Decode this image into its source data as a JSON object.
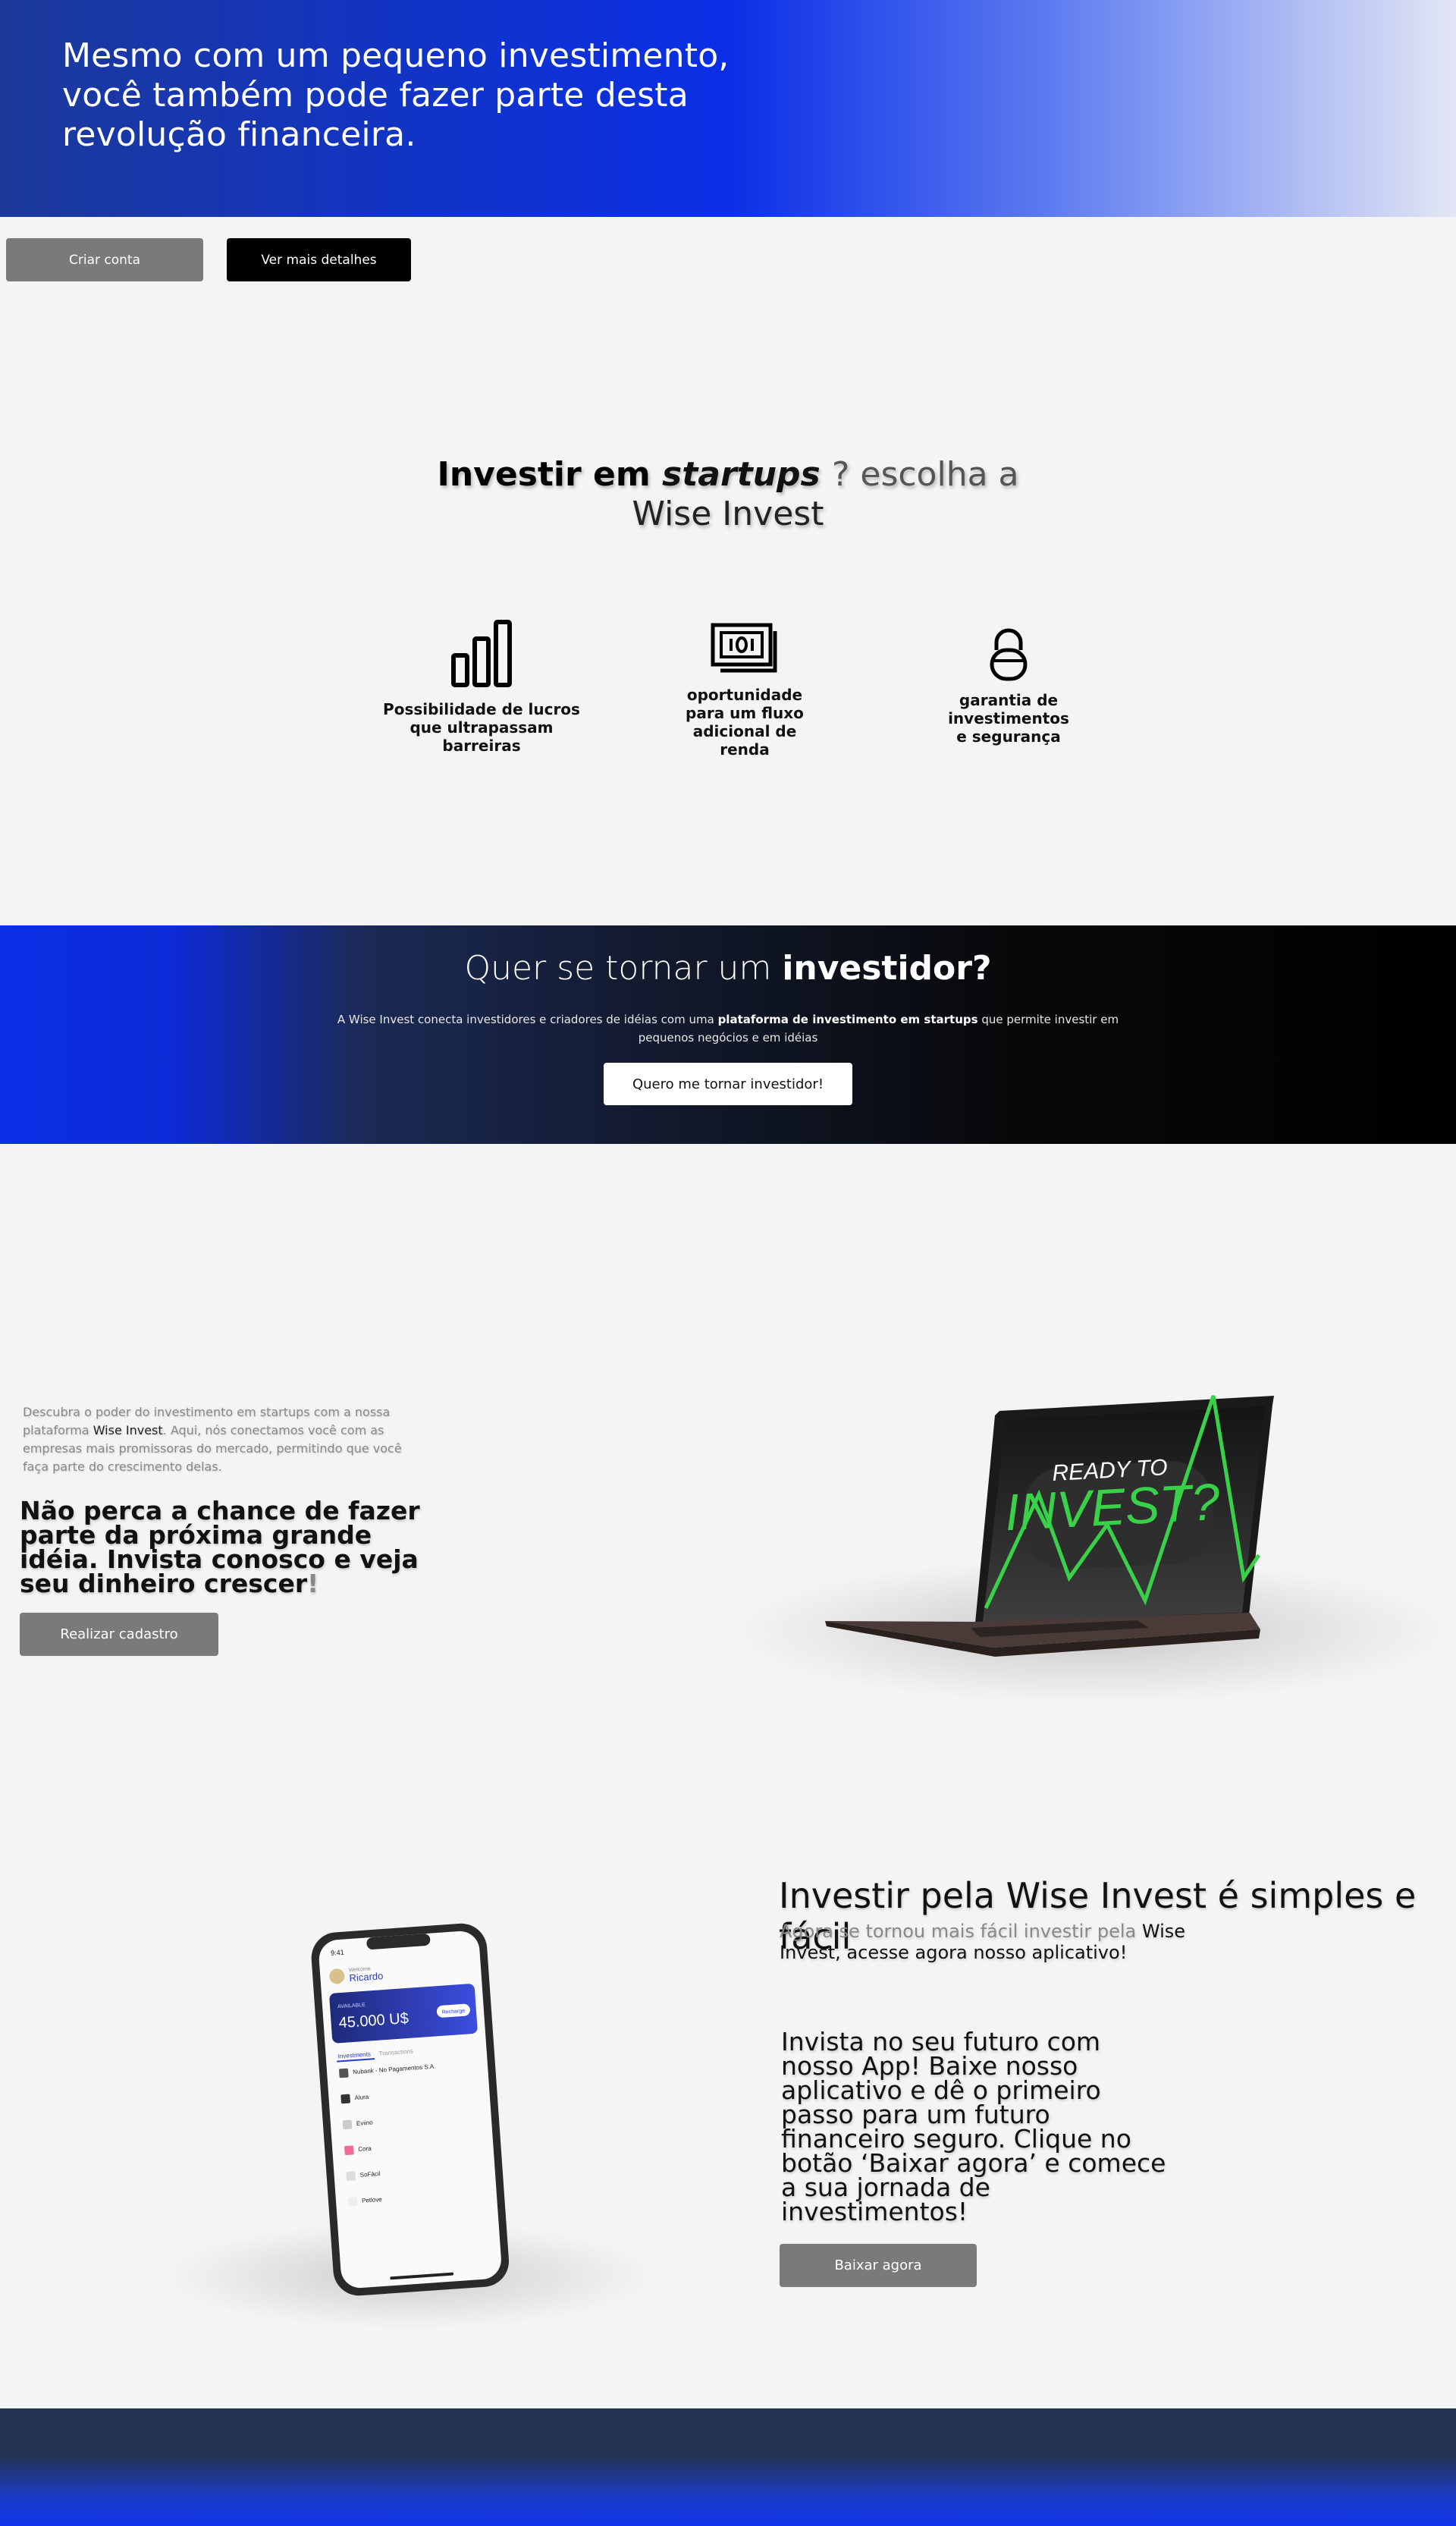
{
  "hero": {
    "title": "Mesmo com um pequeno investimento, você também pode fazer parte desta revolução financeira.",
    "create_account": "Criar conta",
    "more_details": "Ver mais detalhes"
  },
  "why": {
    "title_bold": "Investir em",
    "title_italic": "startups",
    "title_light": "? escolha a",
    "title_line2": "Wise Invest",
    "features": [
      {
        "icon": "bar-chart-icon",
        "label": "Possibilidade de lucros que ultrapassam barreiras"
      },
      {
        "icon": "money-icon",
        "label": "oportunidade para um fluxo adicional de renda"
      },
      {
        "icon": "lock-icon",
        "label": "garantia de investimentos e segurança"
      }
    ]
  },
  "banner": {
    "title_light": "Quer se tornar um",
    "title_bold": "investidor?",
    "desc_pre": "A Wise Invest conecta investidores e criadores de idéias com uma",
    "desc_bold": "plataforma de investimento em startups",
    "desc_post": "que permite investir em pequenos negócios e em idéias",
    "button": "Quero me tornar investidor!"
  },
  "discover": {
    "desc_pre": "Descubra o poder do investimento em startups com a nossa plataforma",
    "desc_brand": "Wise Invest",
    "desc_post": ". Aqui, nós conectamos você com as empresas mais promissoras do mercado, permitindo que você faça parte do crescimento delas.",
    "headline": "Não perca a chance de fazer parte da próxima grande idéia. Invista conosco e veja seu dinheiro crescer",
    "headline_end": "!",
    "button": "Realizar cadastro",
    "laptop_text_1": "READY TO",
    "laptop_text_2": "INVEST?"
  },
  "app": {
    "title": "Investir pela Wise Invest é simples e fácil",
    "sub_pre": "Agora se tornou mais fácil investir pela",
    "sub_brand": "Wise Invest",
    "sub_post": ", acesse agora nosso aplicativo!",
    "body": "Invista no seu futuro com nosso App! Baixe nosso aplicativo e dê o primeiro passo para um futuro financeiro seguro. Clique no botão ‘Baixar agora’ e comece a sua jornada de investimentos!",
    "button": "Baixar agora",
    "phone": {
      "time": "9:41",
      "greeting": "Welcome",
      "user": "Ricardo",
      "balance_label": "AVAILABLE",
      "balance": "45.000 U$",
      "recharge": "Recharge",
      "tab1": "Investments",
      "tab2": "Transactions",
      "items": [
        "Nubank - No Pagamentos S.A.",
        "Alura",
        "Eviino",
        "Cora",
        "SoFácil",
        "Petlove"
      ]
    }
  },
  "colors": {
    "accent_blue": "#0a2fe6",
    "button_grey": "#7a7a7a",
    "background": "#f4f4f4",
    "laptop_green": "#3ad14a"
  }
}
